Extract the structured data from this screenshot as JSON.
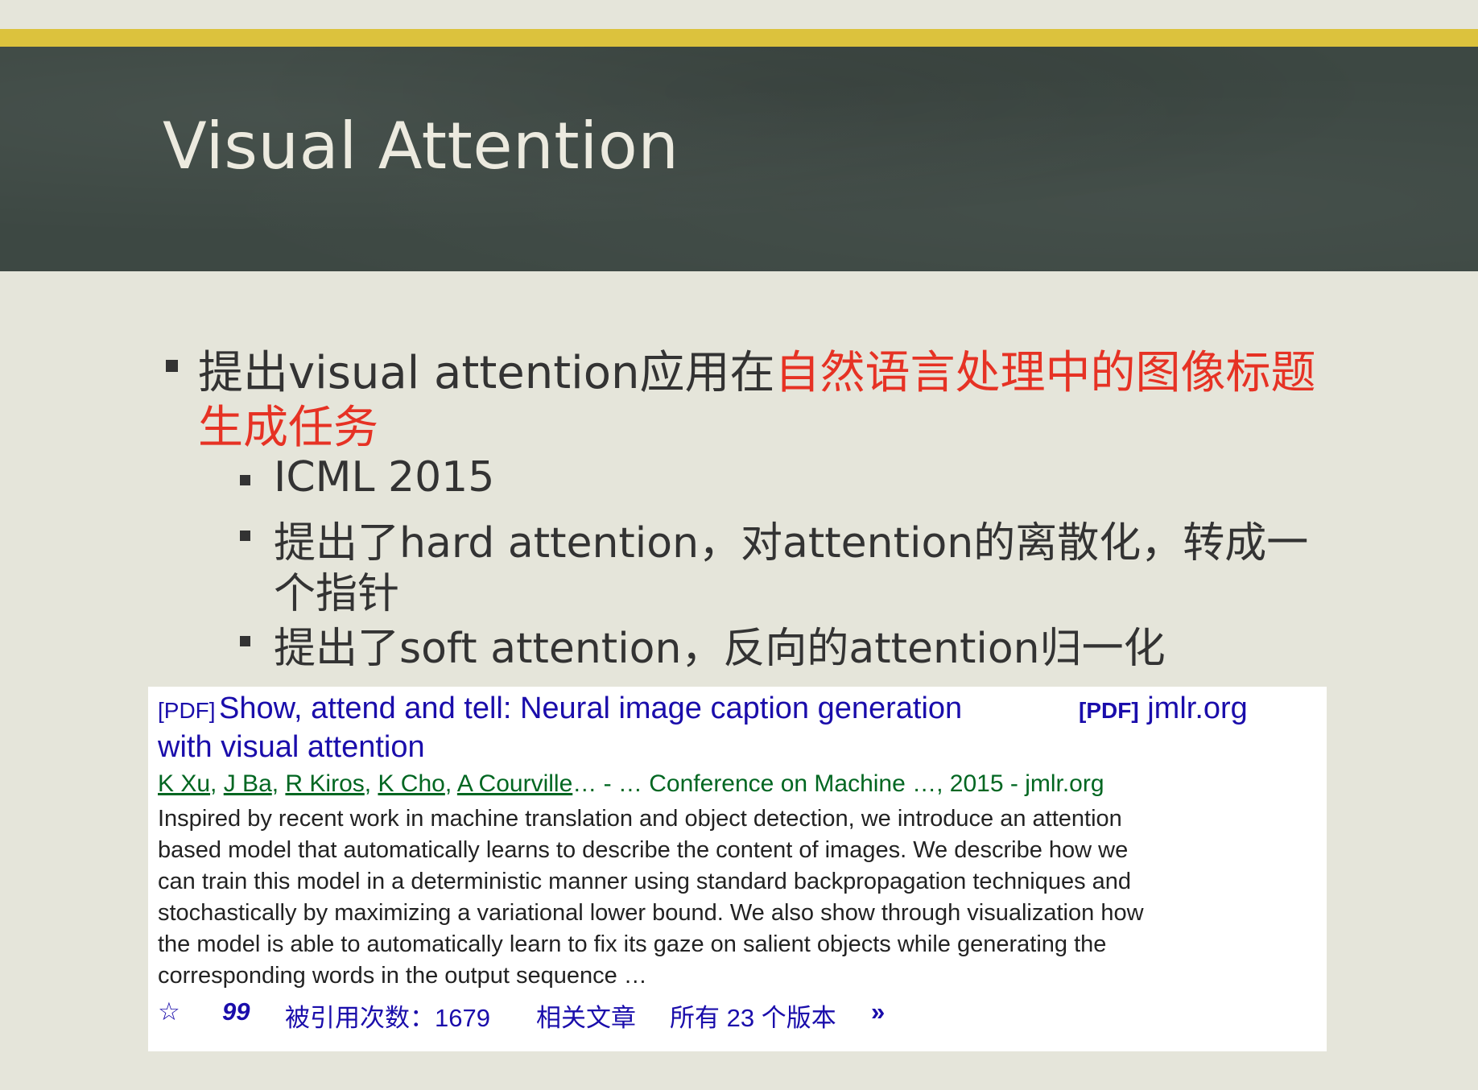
{
  "slide": {
    "title": "Visual Attention",
    "bullets": [
      {
        "line1_plain": "提出visual attention应用在",
        "line1_red": "自然语言处理中的图像标题",
        "line2_red": "生成任务"
      }
    ],
    "sub_bullets": {
      "item1": "ICML 2015",
      "item2_line1": "提出了hard attention，对attention的离散化，转成一",
      "item2_line2": "个指针",
      "item3": "提出了soft attention，反向的attention归一化"
    }
  },
  "search_result": {
    "pdf_tag": "[PDF]",
    "title_line1": "Show, attend and tell: Neural image caption generation",
    "title_line2": "with visual attention",
    "side_pdf_tag": "[PDF]",
    "side_domain": "jmlr.org",
    "authors": [
      "K Xu",
      "J Ba",
      "R Kiros",
      "K Cho",
      "A Courville"
    ],
    "author_seps": [
      ", ",
      ", ",
      ", ",
      ", "
    ],
    "author_tail": "… - … Conference on Machine …, 2015 - jmlr.org",
    "snippet": [
      "Inspired by recent work in machine translation and object detection, we introduce an attention",
      "based model that automatically learns to describe the content of images. We describe how we",
      "can train this model in a deterministic manner using standard backpropagation techniques and",
      "stochastically by maximizing a variational lower bound. We also show through visualization how",
      "the model is able to automatically learn to fix its gaze on salient objects while generating the",
      "corresponding words in the output sequence …"
    ],
    "footer": {
      "star_glyph": "☆",
      "cite_glyph": "99",
      "cited_by": "被引用次数：1679",
      "related": "相关文章",
      "versions": "所有 23 个版本",
      "more_glyph": "»"
    }
  },
  "colors": {
    "gold": "#dcc23d",
    "band": "#3d4843",
    "background": "#e5e5da",
    "red_text": "#e63224",
    "link_blue": "#1a0dab",
    "author_green": "#006621"
  }
}
